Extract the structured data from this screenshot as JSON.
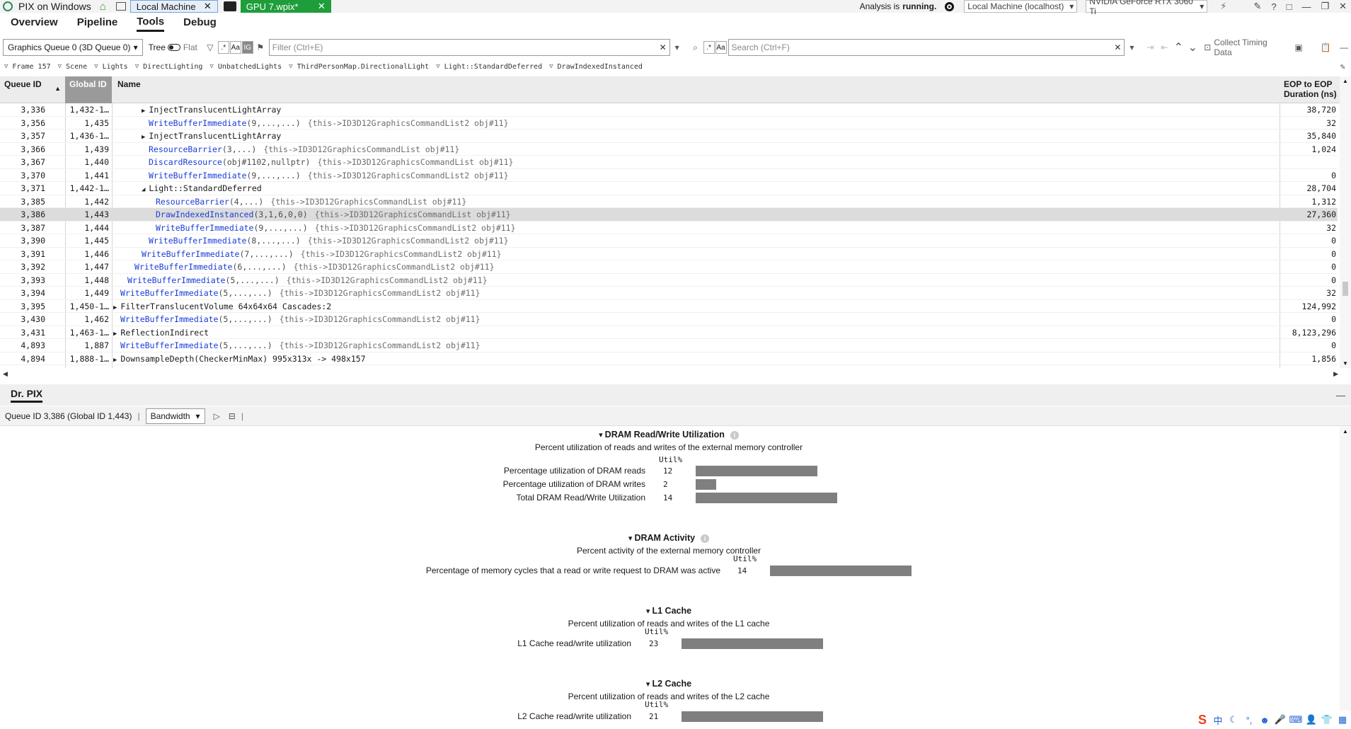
{
  "titlebar": {
    "app_title": "PIX on Windows",
    "tab_local": "Local Machine",
    "tab_gpu": "GPU 7.wpix*",
    "analysis_status_prefix": "Analysis is",
    "analysis_status": "running.",
    "machine_select": "Local Machine (localhost)",
    "gpu_select": "NVIDIA GeForce RTX 3060 Ti"
  },
  "menu": {
    "tabs": [
      "Overview",
      "Pipeline",
      "Tools",
      "Debug"
    ],
    "active": "Tools"
  },
  "toolbar": {
    "queue_select": "Graphics Queue 0 (3D Queue 0)",
    "tree_label": "Tree",
    "flat_label": "Flat",
    "filter_placeholder": "Filter (Ctrl+E)",
    "search_placeholder": "Search (Ctrl+F)",
    "collect_timing": "Collect Timing Data",
    "regex_toggle": ".*",
    "case_toggle": "Aa",
    "ig_toggle": "IG"
  },
  "breadcrumb": [
    "Frame 157",
    "Scene",
    "Lights",
    "DirectLighting",
    "UnbatchedLights",
    "ThirdPersonMap.DirectionalLight",
    "Light::StandardDeferred",
    "DrawIndexedInstanced"
  ],
  "grid": {
    "headers": {
      "queue_id": "Queue ID",
      "global_id": "Global ID",
      "name": "Name",
      "duration_line1": "EOP to EOP",
      "duration_line2": "Duration (ns)"
    },
    "rows": [
      {
        "qid": "3,336",
        "gid": "1,432-1…",
        "expander": "▶",
        "api": "InjectTranslucentLightArray",
        "args": "",
        "obj": "",
        "dur": "38,720",
        "plain": true
      },
      {
        "qid": "3,356",
        "gid": "1,435",
        "expander": "",
        "api": "WriteBufferImmediate",
        "args": "(9,...,...)",
        "obj": "{this->ID3D12GraphicsCommandList2 obj#11}",
        "dur": "32"
      },
      {
        "qid": "3,357",
        "gid": "1,436-1…",
        "expander": "▶",
        "api": "InjectTranslucentLightArray",
        "args": "",
        "obj": "",
        "dur": "35,840",
        "plain": true
      },
      {
        "qid": "3,366",
        "gid": "1,439",
        "expander": "",
        "api": "ResourceBarrier",
        "args": "(3,...)",
        "obj": "{this->ID3D12GraphicsCommandList obj#11}",
        "dur": "1,024"
      },
      {
        "qid": "3,367",
        "gid": "1,440",
        "expander": "",
        "api": "DiscardResource",
        "args": "(obj#1102,nullptr)",
        "obj": "{this->ID3D12GraphicsCommandList obj#11}",
        "dur": ""
      },
      {
        "qid": "3,370",
        "gid": "1,441",
        "expander": "",
        "api": "WriteBufferImmediate",
        "args": "(9,...,...)",
        "obj": "{this->ID3D12GraphicsCommandList2 obj#11}",
        "dur": "0"
      },
      {
        "qid": "3,371",
        "gid": "1,442-1…",
        "expander": "◢",
        "api": "Light::StandardDeferred",
        "args": "",
        "obj": "",
        "dur": "28,704",
        "plain": true
      },
      {
        "qid": "3,385",
        "gid": "1,442",
        "expander": "",
        "api": "ResourceBarrier",
        "args": "(4,...)",
        "obj": "{this->ID3D12GraphicsCommandList obj#11}",
        "dur": "1,312"
      },
      {
        "qid": "3,386",
        "gid": "1,443",
        "expander": "",
        "api": "DrawIndexedInstanced",
        "args": "(3,1,6,0,0)",
        "obj": "{this->ID3D12GraphicsCommandList obj#11}",
        "dur": "27,360",
        "selected": true
      },
      {
        "qid": "3,387",
        "gid": "1,444",
        "expander": "",
        "api": "WriteBufferImmediate",
        "args": "(9,...,...)",
        "obj": "{this->ID3D12GraphicsCommandList2 obj#11}",
        "dur": "32"
      },
      {
        "qid": "3,390",
        "gid": "1,445",
        "expander": "",
        "api": "WriteBufferImmediate",
        "args": "(8,...,...)",
        "obj": "{this->ID3D12GraphicsCommandList2 obj#11}",
        "dur": "0"
      },
      {
        "qid": "3,391",
        "gid": "1,446",
        "expander": "",
        "api": "WriteBufferImmediate",
        "args": "(7,...,...)",
        "obj": "{this->ID3D12GraphicsCommandList2 obj#11}",
        "dur": "0"
      },
      {
        "qid": "3,392",
        "gid": "1,447",
        "expander": "",
        "api": "WriteBufferImmediate",
        "args": "(6,...,...)",
        "obj": "{this->ID3D12GraphicsCommandList2 obj#11}",
        "dur": "0"
      },
      {
        "qid": "3,393",
        "gid": "1,448",
        "expander": "",
        "api": "WriteBufferImmediate",
        "args": "(5,...,...)",
        "obj": "{this->ID3D12GraphicsCommandList2 obj#11}",
        "dur": "0"
      },
      {
        "qid": "3,394",
        "gid": "1,449",
        "expander": "",
        "api": "WriteBufferImmediate",
        "args": "(5,...,...)",
        "obj": "{this->ID3D12GraphicsCommandList2 obj#11}",
        "dur": "32"
      },
      {
        "qid": "3,395",
        "gid": "1,450-1…",
        "expander": "▶",
        "api": "FilterTranslucentVolume 64x64x64 Cascades:2",
        "args": "",
        "obj": "",
        "dur": "124,992",
        "plain": true
      },
      {
        "qid": "3,430",
        "gid": "1,462",
        "expander": "",
        "api": "WriteBufferImmediate",
        "args": "(5,...,...)",
        "obj": "{this->ID3D12GraphicsCommandList2 obj#11}",
        "dur": "0"
      },
      {
        "qid": "3,431",
        "gid": "1,463-1…",
        "expander": "▶",
        "api": "ReflectionIndirect",
        "args": "",
        "obj": "",
        "dur": "8,123,296",
        "plain": true
      },
      {
        "qid": "4,893",
        "gid": "1,887",
        "expander": "",
        "api": "WriteBufferImmediate",
        "args": "(5,...,...)",
        "obj": "{this->ID3D12GraphicsCommandList2 obj#11}",
        "dur": "0"
      },
      {
        "qid": "4,894",
        "gid": "1,888-1…",
        "expander": "▶",
        "api": "DownsampleDepth(CheckerMinMax) 995x313x -> 498x157",
        "args": "",
        "obj": "",
        "dur": "1,856",
        "plain": true
      }
    ]
  },
  "drpix": {
    "title": "Dr. PIX",
    "context": "Queue ID 3,386 (Global ID 1,443)",
    "mode_select": "Bandwidth",
    "sections": [
      {
        "title": "DRAM Read/Write Utilization",
        "subtitle": "Percent utilization of reads and writes of the external memory controller",
        "util_head": "Util%",
        "metrics": [
          {
            "label": "Percentage utilization of DRAM reads",
            "value": "12",
            "pct": 12
          },
          {
            "label": "Percentage utilization of DRAM writes",
            "value": "2",
            "pct": 2
          },
          {
            "label": "Total DRAM Read/Write Utilization",
            "value": "14",
            "pct": 14
          }
        ]
      },
      {
        "title": "DRAM Activity",
        "subtitle": "Percent activity of the external memory controller",
        "util_head": "Util%",
        "metrics": [
          {
            "label": "Percentage of memory cycles that a read or write request to DRAM was active",
            "value": "14",
            "pct": 14
          }
        ]
      },
      {
        "title": "L1 Cache",
        "subtitle": "Percent utilization of reads and writes of the L1 cache",
        "util_head": "Util%",
        "metrics": [
          {
            "label": "L1 Cache read/write utilization",
            "value": "23",
            "pct": 23
          }
        ]
      },
      {
        "title": "L2 Cache",
        "subtitle": "Percent utilization of reads and writes of the L2 cache",
        "util_head": "Util%",
        "metrics": [
          {
            "label": "L2 Cache read/write utilization",
            "value": "21",
            "pct": 21
          }
        ]
      }
    ]
  },
  "tray": {
    "ime_char": "中"
  }
}
